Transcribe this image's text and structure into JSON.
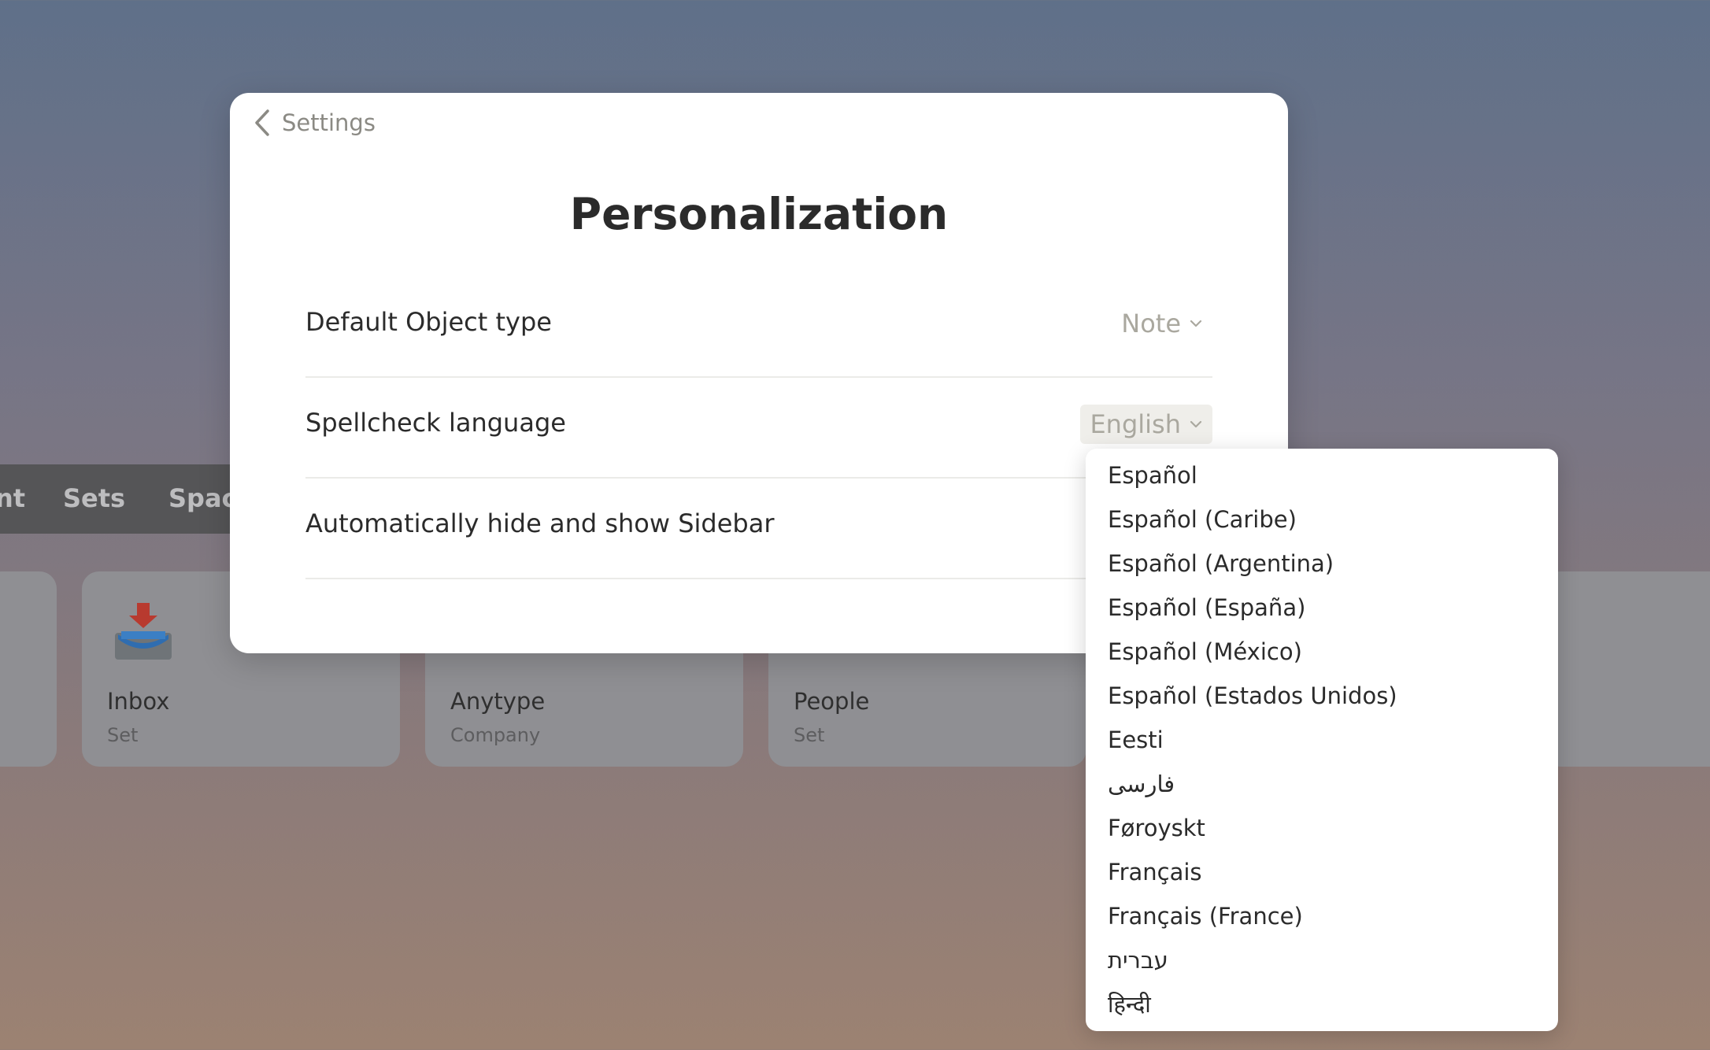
{
  "background": {
    "tabs": [
      "nt",
      "Sets",
      "Spac"
    ],
    "cards": [
      {
        "title": "Inbox",
        "subtitle": "Set",
        "icon": "inbox-tray-icon"
      },
      {
        "title": "Anytype",
        "subtitle": "Company",
        "icon": "avatar"
      },
      {
        "title": "People",
        "subtitle": "Set",
        "icon": "people-icon"
      }
    ]
  },
  "modal": {
    "back_label": "Settings",
    "title": "Personalization",
    "rows": [
      {
        "label": "Default Object type",
        "value": "Note"
      },
      {
        "label": "Spellcheck language",
        "value": "English"
      },
      {
        "label": "Automatically hide and show Sidebar"
      }
    ]
  },
  "dropdown": {
    "options": [
      "Español",
      "Español (Caribe)",
      "Español (Argentina)",
      "Español (España)",
      "Español (México)",
      "Español (Estados Unidos)",
      "Eesti",
      "فارسی",
      "Føroyskt",
      "Français",
      "Français (France)",
      "עברית",
      "हिन्दी"
    ]
  },
  "colors": {
    "accent_text": "#aaa89f",
    "title": "#2b2b2b",
    "muted": "#8b8a84"
  }
}
